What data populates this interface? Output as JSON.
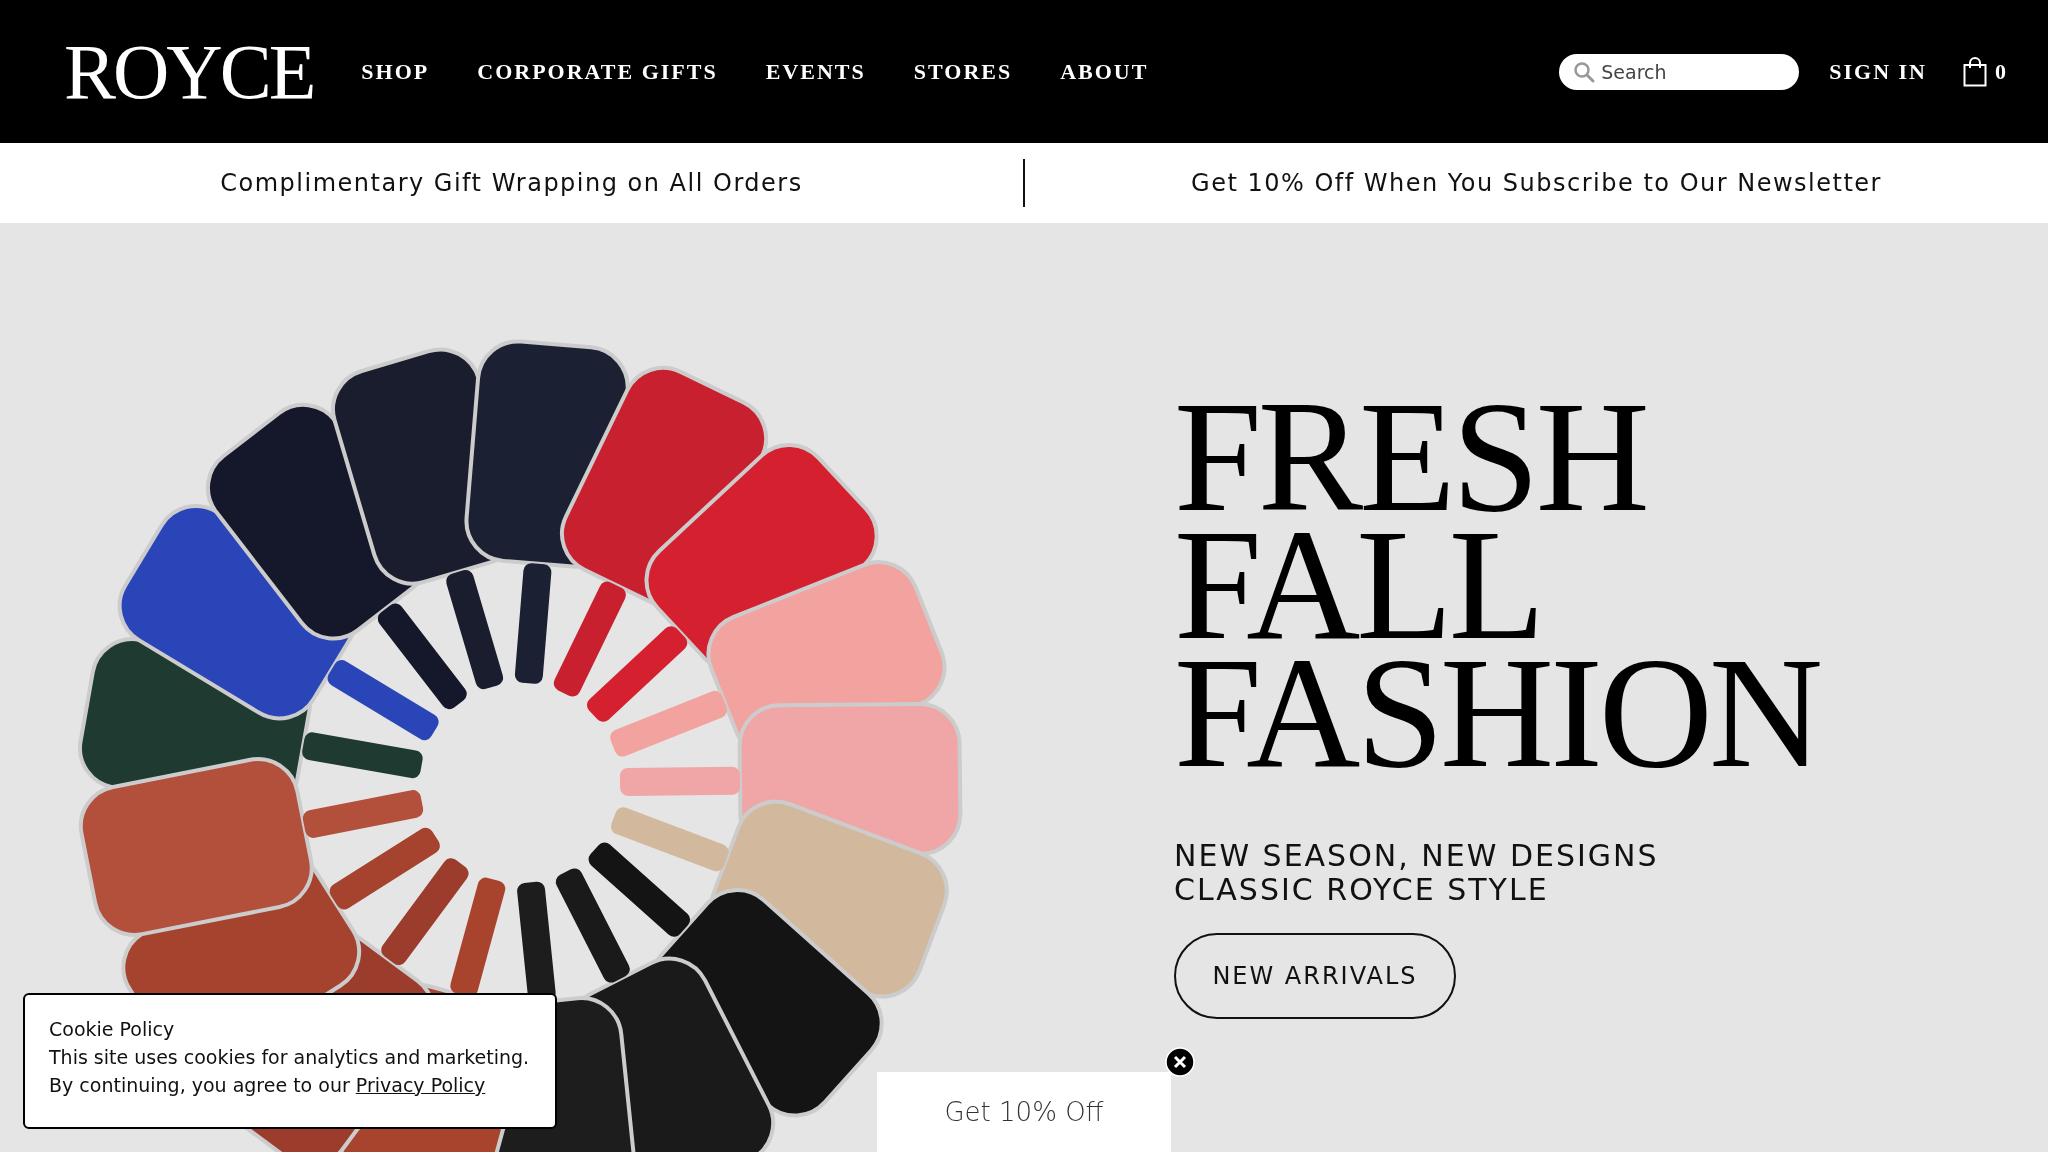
{
  "header": {
    "logo": "ROYCE",
    "nav": [
      "SHOP",
      "CORPORATE GIFTS",
      "EVENTS",
      "STORES",
      "ABOUT"
    ],
    "search": {
      "placeholder": "Search"
    },
    "sign_in": "SIGN IN",
    "cart_count": "0"
  },
  "promo_bar": [
    "Complimentary Gift Wrapping on All Orders",
    "Get 10% Off When You Subscribe to Our Newsletter"
  ],
  "hero": {
    "headline": [
      "FRESH",
      "FALL",
      "FASHION"
    ],
    "subtitle": [
      "NEW SEASON, NEW DESIGNS",
      "CLASSIC ROYCE STYLE"
    ],
    "button": "NEW ARRIVALS"
  },
  "cookie": {
    "title": "Cookie Policy",
    "text": "This site uses cookies for analytics and marketing. By continuing, you agree to our",
    "link": "Privacy Policy"
  },
  "offer_tab": {
    "label": "Get 10% Off"
  }
}
